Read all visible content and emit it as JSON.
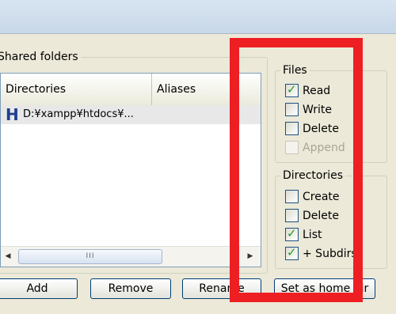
{
  "shared_folders": {
    "title": "Shared folders",
    "columns": {
      "directories": "Directories",
      "aliases": "Aliases"
    },
    "rows": [
      {
        "directory": "D:¥xampp¥htdocs¥...",
        "alias": ""
      }
    ],
    "scrollbar_thumb_grip": "III"
  },
  "files_group": {
    "title": "Files",
    "items": [
      {
        "label": "Read",
        "checked": true,
        "enabled": true
      },
      {
        "label": "Write",
        "checked": false,
        "enabled": true
      },
      {
        "label": "Delete",
        "checked": false,
        "enabled": true
      },
      {
        "label": "Append",
        "checked": false,
        "enabled": false
      }
    ]
  },
  "directories_group": {
    "title": "Directories",
    "items": [
      {
        "label": "Create",
        "checked": false,
        "enabled": true
      },
      {
        "label": "Delete",
        "checked": false,
        "enabled": true
      },
      {
        "label": "List",
        "checked": true,
        "enabled": true
      },
      {
        "label": "+ Subdirs",
        "checked": true,
        "enabled": true
      }
    ]
  },
  "buttons": {
    "add": "Add",
    "remove": "Remove",
    "rename": "Rename",
    "set_home": "Set as home dir"
  },
  "highlight_color": "#ee1f23"
}
